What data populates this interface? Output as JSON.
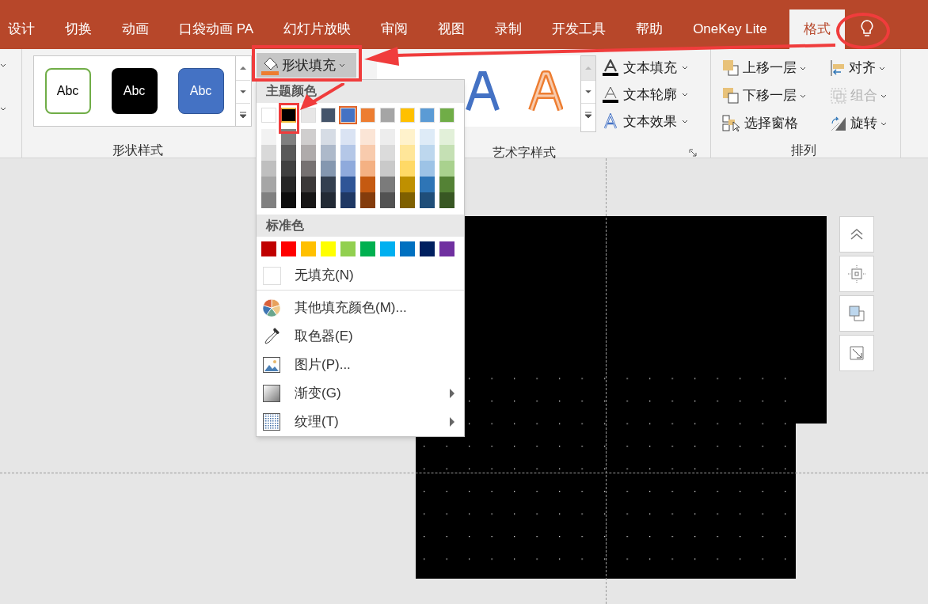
{
  "tabs": [
    {
      "label": "设计",
      "selected": false
    },
    {
      "label": "切换",
      "selected": false
    },
    {
      "label": "动画",
      "selected": false
    },
    {
      "label": "口袋动画 PA",
      "selected": false
    },
    {
      "label": "幻灯片放映",
      "selected": false
    },
    {
      "label": "审阅",
      "selected": false
    },
    {
      "label": "视图",
      "selected": false
    },
    {
      "label": "录制",
      "selected": false
    },
    {
      "label": "开发工具",
      "selected": false
    },
    {
      "label": "帮助",
      "selected": false
    },
    {
      "label": "OneKey Lite",
      "selected": false
    },
    {
      "label": "格式",
      "selected": true
    }
  ],
  "shape_styles": {
    "items": [
      {
        "label": "Abc",
        "kind": "outline"
      },
      {
        "label": "Abc",
        "kind": "dark"
      },
      {
        "label": "Abc",
        "kind": "blue"
      }
    ],
    "group_label": "形状样式"
  },
  "shape_fill_button": {
    "label": "形状填充"
  },
  "wordart": {
    "items": [
      {
        "kind": "blue"
      },
      {
        "kind": "orange"
      }
    ],
    "commands": [
      {
        "label": "文本填充",
        "kind": "fill"
      },
      {
        "label": "文本轮廓",
        "kind": "outline"
      },
      {
        "label": "文本效果",
        "kind": "effect"
      }
    ],
    "group_label": "艺术字样式"
  },
  "arrange": {
    "commands": [
      {
        "label": "上移一层",
        "kind": "forward",
        "disabled": false
      },
      {
        "label": "对齐",
        "kind": "align",
        "disabled": false
      },
      {
        "label": "下移一层",
        "kind": "backward",
        "disabled": false
      },
      {
        "label": "组合",
        "kind": "group",
        "disabled": true
      },
      {
        "label": "选择窗格",
        "kind": "pane",
        "disabled": false
      },
      {
        "label": "旋转",
        "kind": "rotate",
        "disabled": false
      }
    ],
    "group_label": "排列"
  },
  "fill_menu": {
    "theme_header": "主题颜色",
    "theme_colors": [
      {
        "color": "#ffffff",
        "selected": false,
        "highlighted": false,
        "shades": [
          {
            "color": "#f2f2f2"
          },
          {
            "color": "#d9d9d9"
          },
          {
            "color": "#bfbfbf"
          },
          {
            "color": "#a6a6a6"
          },
          {
            "color": "#808080"
          }
        ]
      },
      {
        "color": "#000000",
        "selected": false,
        "highlighted": true,
        "shades": [
          {
            "color": "#808080"
          },
          {
            "color": "#595959"
          },
          {
            "color": "#404040"
          },
          {
            "color": "#262626"
          },
          {
            "color": "#0d0d0d"
          }
        ]
      },
      {
        "color": "#e7e6e6",
        "selected": false,
        "highlighted": false,
        "shades": [
          {
            "color": "#d0cece"
          },
          {
            "color": "#afabab"
          },
          {
            "color": "#767171"
          },
          {
            "color": "#3b3838"
          },
          {
            "color": "#171616"
          }
        ]
      },
      {
        "color": "#44546a",
        "selected": false,
        "highlighted": false,
        "shades": [
          {
            "color": "#d6dce5"
          },
          {
            "color": "#adb9ca"
          },
          {
            "color": "#8497b0"
          },
          {
            "color": "#333f50"
          },
          {
            "color": "#222a35"
          }
        ]
      },
      {
        "color": "#4472c4",
        "selected": true,
        "highlighted": false,
        "shades": [
          {
            "color": "#dae3f3"
          },
          {
            "color": "#b4c7e7"
          },
          {
            "color": "#8faadc"
          },
          {
            "color": "#2f5597"
          },
          {
            "color": "#1f3864"
          }
        ]
      },
      {
        "color": "#ed7d31",
        "selected": false,
        "highlighted": false,
        "shades": [
          {
            "color": "#fbe5d6"
          },
          {
            "color": "#f8cbad"
          },
          {
            "color": "#f4b183"
          },
          {
            "color": "#c55a11"
          },
          {
            "color": "#843c0c"
          }
        ]
      },
      {
        "color": "#a5a5a5",
        "selected": false,
        "highlighted": false,
        "shades": [
          {
            "color": "#ededed"
          },
          {
            "color": "#dbdbdb"
          },
          {
            "color": "#c9c9c9"
          },
          {
            "color": "#7b7b7b"
          },
          {
            "color": "#525252"
          }
        ]
      },
      {
        "color": "#ffc000",
        "selected": false,
        "highlighted": false,
        "shades": [
          {
            "color": "#fff2cc"
          },
          {
            "color": "#ffe699"
          },
          {
            "color": "#ffd966"
          },
          {
            "color": "#bf9000"
          },
          {
            "color": "#7f6000"
          }
        ]
      },
      {
        "color": "#5b9bd5",
        "selected": false,
        "highlighted": false,
        "shades": [
          {
            "color": "#deebf7"
          },
          {
            "color": "#bdd7ee"
          },
          {
            "color": "#9dc3e6"
          },
          {
            "color": "#2e75b6"
          },
          {
            "color": "#1f4e79"
          }
        ]
      },
      {
        "color": "#70ad47",
        "selected": false,
        "highlighted": false,
        "shades": [
          {
            "color": "#e2f0d9"
          },
          {
            "color": "#c5e0b4"
          },
          {
            "color": "#a9d18e"
          },
          {
            "color": "#548235"
          },
          {
            "color": "#385723"
          }
        ]
      }
    ],
    "standard_header": "标准色",
    "standard_colors": [
      {
        "color": "#c00000"
      },
      {
        "color": "#ff0000"
      },
      {
        "color": "#ffc000"
      },
      {
        "color": "#ffff00"
      },
      {
        "color": "#92d050"
      },
      {
        "color": "#00b050"
      },
      {
        "color": "#00b0f0"
      },
      {
        "color": "#0070c0"
      },
      {
        "color": "#002060"
      },
      {
        "color": "#7030a0"
      }
    ],
    "items": [
      {
        "label": "无填充(N)",
        "kind": "none",
        "submenu": false
      },
      {
        "label": "其他填充颜色(M)...",
        "kind": "more",
        "submenu": false
      },
      {
        "label": "取色器(E)",
        "kind": "eyedropper",
        "submenu": false
      },
      {
        "label": "图片(P)...",
        "kind": "picture",
        "submenu": false
      },
      {
        "label": "渐变(G)",
        "kind": "gradient",
        "submenu": true
      },
      {
        "label": "纹理(T)",
        "kind": "texture",
        "submenu": true
      }
    ]
  }
}
